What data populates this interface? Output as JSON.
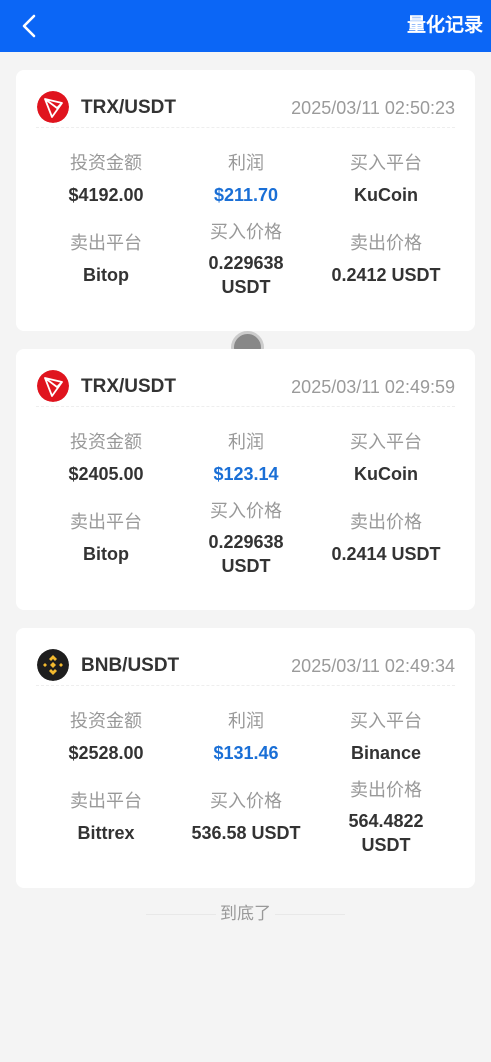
{
  "header": {
    "title": "量化记录"
  },
  "labels": {
    "invest": "投资金额",
    "profit": "利润",
    "buy_platform": "买入平台",
    "sell_platform": "卖出平台",
    "buy_price": "买入价格",
    "sell_price": "卖出价格"
  },
  "records": [
    {
      "pair": "TRX/USDT",
      "time": "2025/03/11 02:50:23",
      "icon": "tron-icon",
      "invest": "$4192.00",
      "profit": "$211.70",
      "buy_platform": "KuCoin",
      "sell_platform": "Bitop",
      "buy_price_1": "0.229638",
      "buy_price_2": "USDT",
      "sell_price": "0.2412 USDT"
    },
    {
      "pair": "TRX/USDT",
      "time": "2025/03/11 02:49:59",
      "icon": "tron-icon",
      "invest": "$2405.00",
      "profit": "$123.14",
      "buy_platform": "KuCoin",
      "sell_platform": "Bitop",
      "buy_price_1": "0.229638",
      "buy_price_2": "USDT",
      "sell_price": "0.2414 USDT"
    },
    {
      "pair": "BNB/USDT",
      "time": "2025/03/11 02:49:34",
      "icon": "bnb-icon",
      "invest": "$2528.00",
      "profit": "$131.46",
      "buy_platform": "Binance",
      "sell_platform": "Bittrex",
      "buy_price": "536.58 USDT",
      "sell_price_1": "564.4822",
      "sell_price_2": "USDT"
    }
  ],
  "footer": {
    "end_text": "到底了"
  },
  "colors": {
    "header_bg": "#0b66f6",
    "profit": "#1a6fd6",
    "tron_red": "#e0141e",
    "bnb_yellow": "#f3ba2f"
  }
}
